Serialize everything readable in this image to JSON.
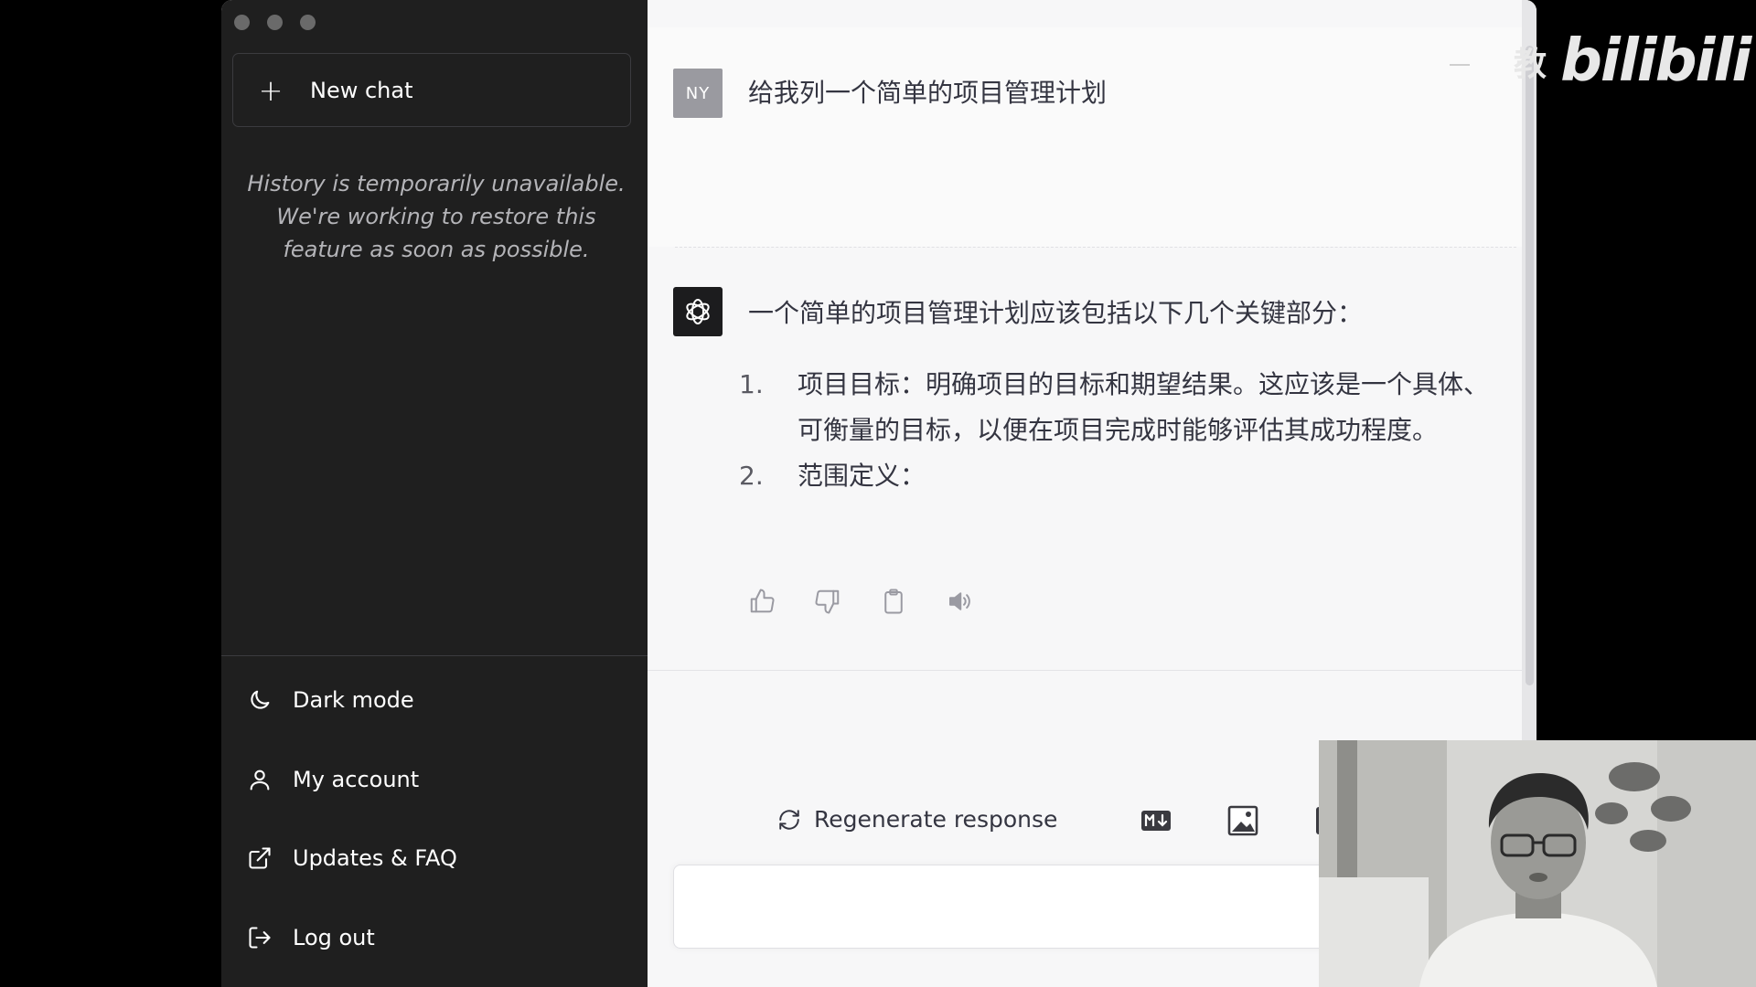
{
  "sidebar": {
    "new_chat_label": "New chat",
    "history_note": "History is temporarily unavailable. We're working to restore this feature as soon as possible.",
    "items": [
      {
        "label": "Dark mode",
        "icon": "moon-icon"
      },
      {
        "label": "My account",
        "icon": "user-icon"
      },
      {
        "label": "Updates & FAQ",
        "icon": "external-link-icon"
      },
      {
        "label": "Log out",
        "icon": "logout-icon"
      }
    ]
  },
  "conversation": {
    "user": {
      "avatar_initials": "NY",
      "message": "给我列一个简单的项目管理计划"
    },
    "assistant": {
      "intro": "一个简单的项目管理计划应该包括以下几个关键部分：",
      "list": [
        {
          "num": "1.",
          "text": "项目目标：明确项目的目标和期望结果。这应该是一个具体、可衡量的目标，以便在项目完成时能够评估其成功程度。"
        },
        {
          "num": "2.",
          "text": "范围定义："
        }
      ]
    }
  },
  "actions": {
    "regenerate_label": "Regenerate response",
    "exports": [
      "markdown-icon",
      "image-icon",
      "pdf-icon"
    ]
  },
  "overlay": {
    "watermark_cn": "教",
    "watermark_logo": "bilibili"
  },
  "colors": {
    "sidebar_bg": "#1f1f1f",
    "main_bg": "#f7f7f8",
    "text": "#343541"
  }
}
